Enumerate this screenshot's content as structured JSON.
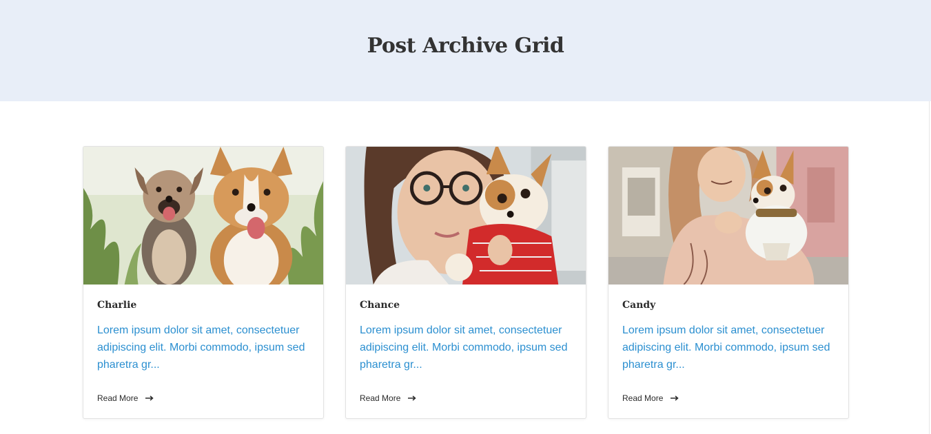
{
  "page": {
    "title": "Post Archive Grid"
  },
  "posts": [
    {
      "title": "Charlie",
      "excerpt": "Lorem ipsum dolor sit amet, consectetuer adipiscing elit. Morbi commodo, ipsum sed pharetra gr...",
      "read_more": "Read More",
      "image": "two-dogs-in-grass"
    },
    {
      "title": "Chance",
      "excerpt": "Lorem ipsum dolor sit amet, consectetuer adipiscing elit. Morbi commodo, ipsum sed pharetra gr...",
      "read_more": "Read More",
      "image": "woman-with-glasses-holding-chihuahua"
    },
    {
      "title": "Candy",
      "excerpt": "Lorem ipsum dolor sit amet, consectetuer adipiscing elit. Morbi commodo, ipsum sed pharetra gr...",
      "read_more": "Read More",
      "image": "woman-holding-chihuahua-on-street"
    }
  ],
  "colors": {
    "hero_bg": "#e8eef8",
    "excerpt": "#2b8fd0",
    "title": "#333333"
  },
  "icons": {
    "read_more": "arrow-right-icon"
  }
}
